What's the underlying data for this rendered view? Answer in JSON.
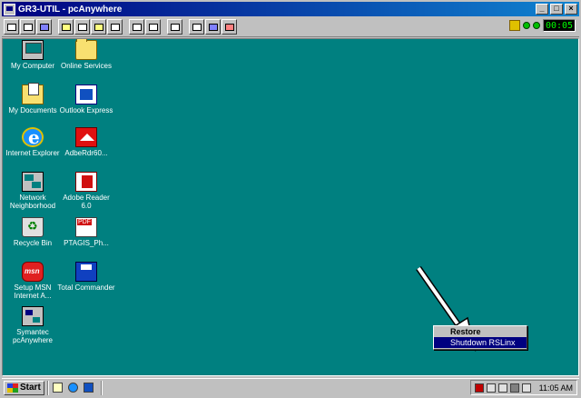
{
  "window": {
    "title": "GR3-UTIL - pcAnywhere",
    "controls": {
      "minimize": "_",
      "maximize": "□",
      "close": "×"
    }
  },
  "toolbar": {
    "timer": "00:05"
  },
  "desktop": {
    "background_color": "#008080",
    "icons": [
      {
        "label": "My Computer",
        "icon": "computer-icon"
      },
      {
        "label": "Online Services",
        "icon": "folder-icon"
      },
      {
        "label": "My Documents",
        "icon": "documents-folder-icon"
      },
      {
        "label": "Outlook Express",
        "icon": "outlook-express-icon"
      },
      {
        "label": "Internet Explorer",
        "icon": "internet-explorer-icon"
      },
      {
        "label": "AdbeRdr60...",
        "icon": "adobe-installer-icon"
      },
      {
        "label": "Network Neighborhood",
        "icon": "network-icon"
      },
      {
        "label": "Adobe Reader 6.0",
        "icon": "adobe-reader-icon"
      },
      {
        "label": "Recycle Bin",
        "icon": "recycle-bin-icon"
      },
      {
        "label": "PTAGIS_Ph...",
        "icon": "pdf-file-icon"
      },
      {
        "label": "Setup MSN Internet A...",
        "icon": "msn-icon"
      },
      {
        "label": "Total Commander",
        "icon": "total-commander-icon"
      },
      {
        "label": "Symantec pcAnywhere",
        "icon": "pcanywhere-icon"
      }
    ]
  },
  "context_menu": {
    "items": [
      {
        "label": "Restore",
        "bold": true,
        "selected": false
      },
      {
        "label": "Shutdown RSLinx",
        "bold": false,
        "selected": true
      }
    ]
  },
  "taskbar": {
    "start_label": "Start",
    "clock": "11:05 AM"
  }
}
